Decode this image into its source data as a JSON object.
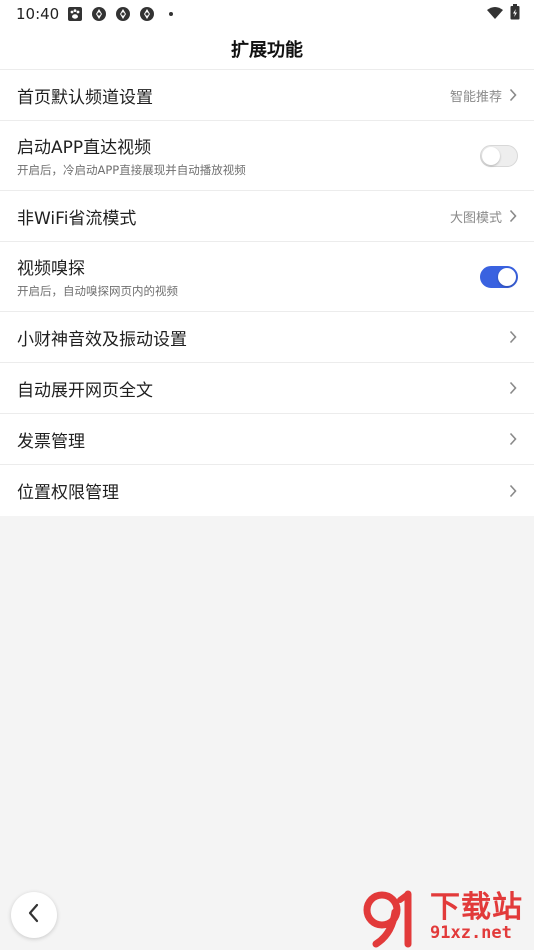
{
  "status_bar": {
    "time": "10:40",
    "icons": [
      "paw-notification-icon",
      "aperture-notification-icon",
      "aperture-notification-icon",
      "aperture-notification-icon",
      "dot-icon"
    ],
    "right_icons": [
      "wifi-icon",
      "battery-icon"
    ]
  },
  "header": {
    "title": "扩展功能"
  },
  "settings": {
    "home_channel": {
      "title": "首页默认频道设置",
      "value": "智能推荐"
    },
    "startup_video": {
      "title": "启动APP直达视频",
      "subtitle": "开启后，冷启动APP直接展现并自动播放视频",
      "enabled": false
    },
    "non_wifi": {
      "title": "非WiFi省流模式",
      "value": "大图模式"
    },
    "video_sniff": {
      "title": "视频嗅探",
      "subtitle": "开启后，自动嗅探网页内的视频",
      "enabled": true
    },
    "sound_vibration": {
      "title": "小财神音效及振动设置"
    },
    "auto_expand": {
      "title": "自动展开网页全文"
    },
    "invoice": {
      "title": "发票管理"
    },
    "location_permission": {
      "title": "位置权限管理"
    }
  },
  "watermark": {
    "cn": "下载站",
    "url": "91xz.net",
    "logo_text": "91"
  },
  "colors": {
    "accent": "#3a62e0",
    "watermark": "#e23a3a"
  }
}
